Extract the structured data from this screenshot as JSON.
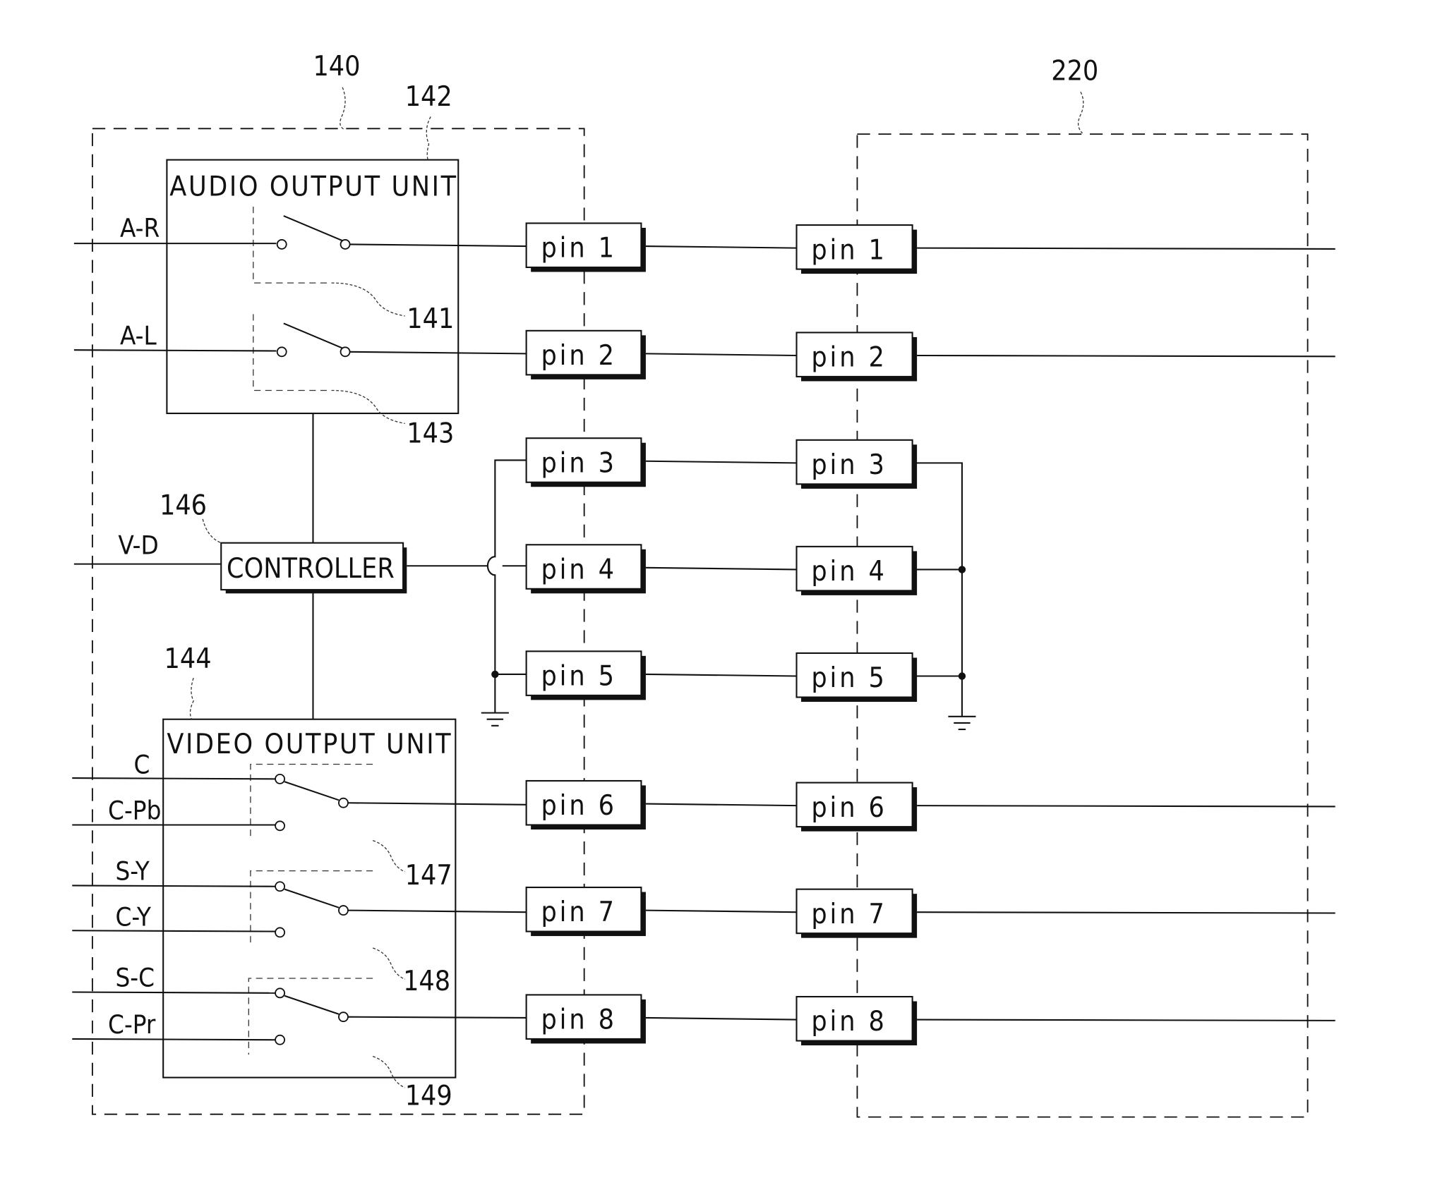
{
  "figure": {
    "connector_left": {
      "ref": "140"
    },
    "connector_right": {
      "ref": "220"
    },
    "audio_unit": {
      "ref": "142",
      "title": "AUDIO OUTPUT UNIT",
      "switches": [
        {
          "ref": "141",
          "input": "A-R",
          "pin": "pin 1"
        },
        {
          "ref": "143",
          "input": "A-L",
          "pin": "pin 2"
        }
      ]
    },
    "controller": {
      "ref": "146",
      "title": "CONTROLLER",
      "input": "V-D"
    },
    "video_unit": {
      "ref": "144",
      "title": "VIDEO OUTPUT UNIT",
      "switches": [
        {
          "ref": "147",
          "inputs": [
            "C",
            "C-Pb"
          ],
          "pin": "pin 6"
        },
        {
          "ref": "148",
          "inputs": [
            "S-Y",
            "C-Y"
          ],
          "pin": "pin 7"
        },
        {
          "ref": "149",
          "inputs": [
            "S-C",
            "C-Pr"
          ],
          "pin": "pin 8"
        }
      ]
    },
    "left_pins": [
      "pin 1",
      "pin 2",
      "pin 3",
      "pin 4",
      "pin 5",
      "pin 6",
      "pin 7",
      "pin 8"
    ],
    "right_pins": [
      "pin 1",
      "pin 2",
      "pin 3",
      "pin 4",
      "pin 5",
      "pin 6",
      "pin 7",
      "pin 8"
    ]
  }
}
